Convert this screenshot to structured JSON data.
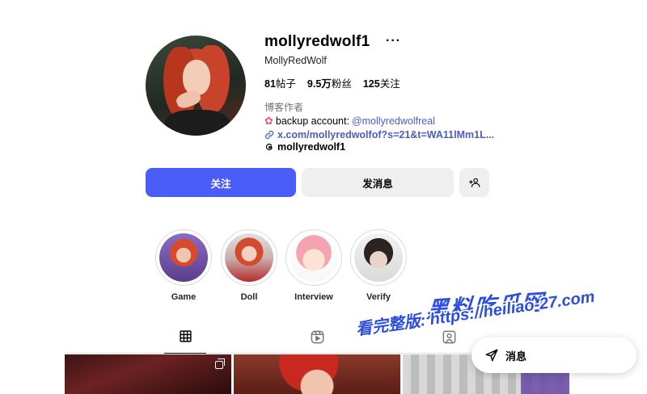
{
  "profile": {
    "username": "mollyredwolf1",
    "more_label": "···",
    "full_name": "MollyRedWolf",
    "stats": {
      "posts": "81",
      "posts_label": "帖子",
      "followers": "9.5万",
      "followers_label": "粉丝",
      "following": "125",
      "following_label": "关注"
    },
    "category": "博客作者",
    "bio_prefix": "backup account: ",
    "bio_mention": "@mollyredwolfreal",
    "link": "x.com/mollyredwolfof?s=21&t=WA11lMm1L...",
    "threads_handle": "mollyredwolf1"
  },
  "actions": {
    "follow_label": "关注",
    "message_label": "发消息"
  },
  "highlights": [
    {
      "label": "Game"
    },
    {
      "label": "Doll"
    },
    {
      "label": "Interview"
    },
    {
      "label": "Verify"
    }
  ],
  "tabs": [
    {
      "icon": "grid-icon",
      "active": true
    },
    {
      "icon": "reels-icon"
    },
    {
      "icon": "tagged-icon"
    }
  ],
  "messages_pill": {
    "label": "消息"
  },
  "watermark": {
    "line1": "黑料吃瓜网",
    "line2": "看完整版: https://heiliao-27.com"
  },
  "colors": {
    "accent": "#4a5df9",
    "link": "#4a5ebf",
    "secondary_bg": "#efefef"
  }
}
